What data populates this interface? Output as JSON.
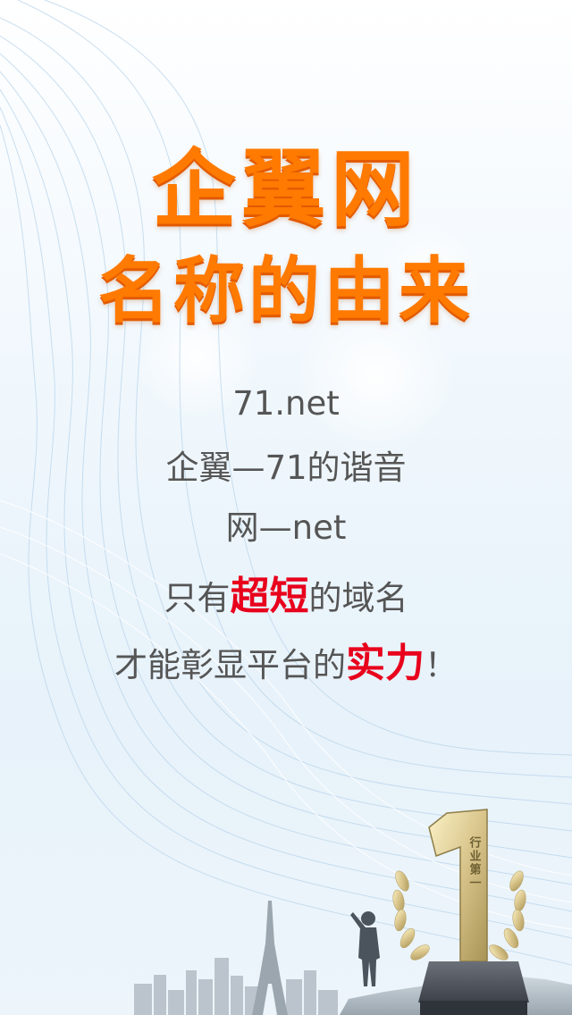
{
  "title": {
    "line1": "企翼网",
    "line2": "名称的由来"
  },
  "body": {
    "line1": "71.net",
    "line2": "企翼—71的谐音",
    "line3": "网—net",
    "line4": {
      "before": "只有",
      "highlight": "超短",
      "after": "的域名"
    },
    "line5": {
      "before": "才能彰显平台的",
      "highlight": "实力",
      "after": "！"
    }
  },
  "trophy": {
    "numeral": "1",
    "inscription": "行业第一"
  },
  "colors": {
    "title": "#ff7a00",
    "body_text": "#555555",
    "highlight": "#e8001c",
    "background": "#eef6fc"
  }
}
